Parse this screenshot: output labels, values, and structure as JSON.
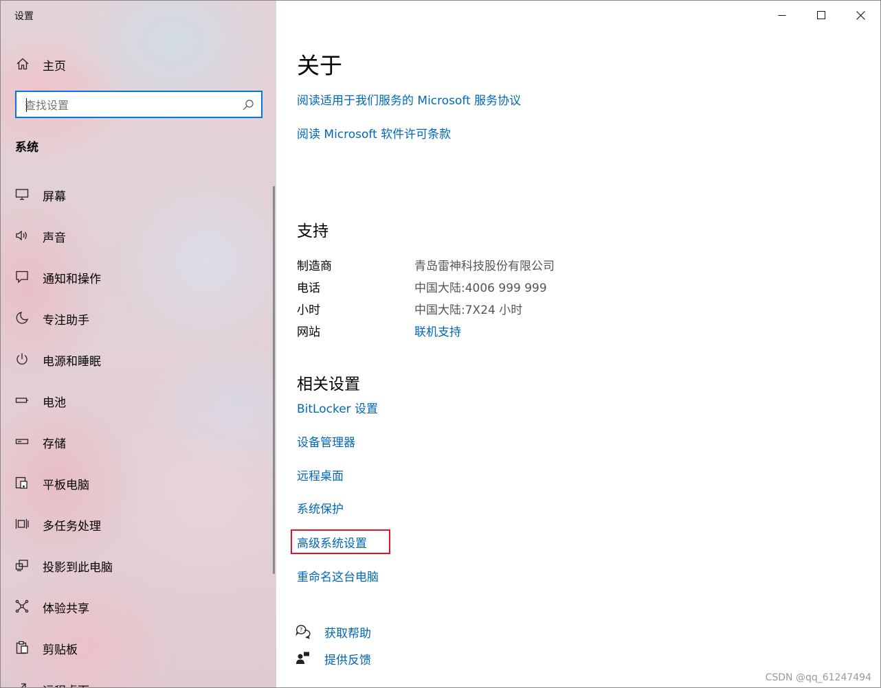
{
  "window": {
    "title": "设置"
  },
  "sidebar": {
    "home_label": "主页",
    "search_placeholder": "查找设置",
    "section": "系统",
    "items": [
      {
        "label": "屏幕",
        "icon": "display-icon"
      },
      {
        "label": "声音",
        "icon": "speaker-icon"
      },
      {
        "label": "通知和操作",
        "icon": "notification-icon"
      },
      {
        "label": "专注助手",
        "icon": "moon-icon"
      },
      {
        "label": "电源和睡眠",
        "icon": "power-icon"
      },
      {
        "label": "电池",
        "icon": "battery-icon"
      },
      {
        "label": "存储",
        "icon": "storage-icon"
      },
      {
        "label": "平板电脑",
        "icon": "tablet-icon"
      },
      {
        "label": "多任务处理",
        "icon": "multitask-icon"
      },
      {
        "label": "投影到此电脑",
        "icon": "project-icon"
      },
      {
        "label": "体验共享",
        "icon": "share-icon"
      },
      {
        "label": "剪贴板",
        "icon": "clipboard-icon"
      },
      {
        "label": "远程桌面",
        "icon": "remote-icon"
      }
    ]
  },
  "content": {
    "title": "关于",
    "top_links": [
      "阅读适用于我们服务的 Microsoft 服务协议",
      "阅读 Microsoft 软件许可条款"
    ],
    "support": {
      "heading": "支持",
      "rows": [
        {
          "key": "制造商",
          "value": "青岛雷神科技股份有限公司",
          "is_link": false
        },
        {
          "key": "电话",
          "value": "中国大陆:4006 999 999",
          "is_link": false
        },
        {
          "key": "小时",
          "value": "中国大陆:7X24 小时",
          "is_link": false
        },
        {
          "key": "网站",
          "value": "联机支持",
          "is_link": true
        }
      ]
    },
    "related": {
      "heading": "相关设置",
      "links": [
        "BitLocker 设置",
        "设备管理器",
        "远程桌面",
        "系统保护",
        "高级系统设置",
        "重命名这台电脑"
      ]
    },
    "help": {
      "get_help": "获取帮助",
      "feedback": "提供反馈"
    }
  },
  "watermark": "CSDN @qq_61247494",
  "colors": {
    "link": "#0067b8",
    "accent": "#0078d7",
    "highlight": "#e81123"
  }
}
